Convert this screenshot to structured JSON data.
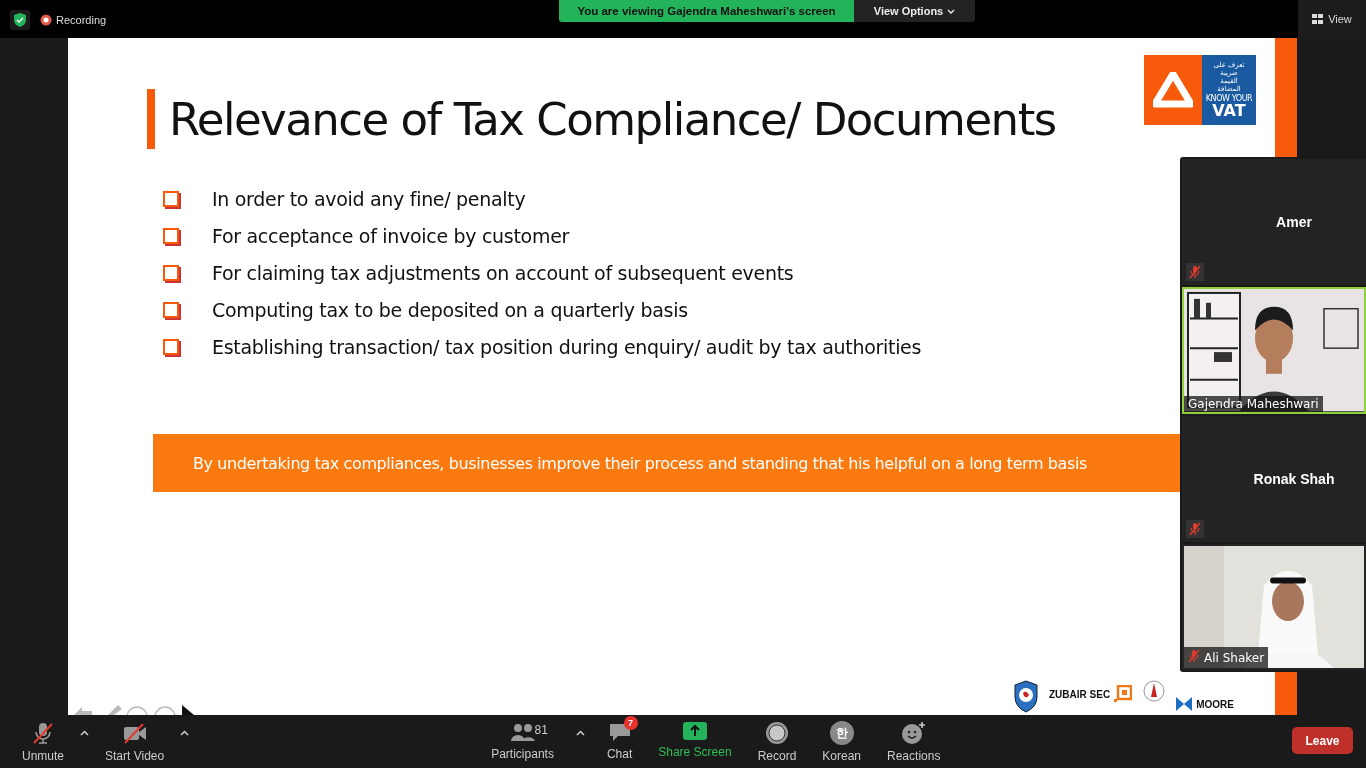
{
  "top_bar": {
    "recording": "Recording",
    "banner": "You are viewing Gajendra Maheshwari's screen",
    "view_options": "View Options",
    "view": "View"
  },
  "slide": {
    "title": "Relevance of Tax Compliance/ Documents",
    "logo": {
      "arabic": [
        "تعرف على",
        "ضريبة",
        "القيمة",
        "المضافة"
      ],
      "english_top": "KNOW YOUR",
      "english_main": "VAT"
    },
    "bullets": [
      "In order to avoid any fine/ penalty",
      "For acceptance of invoice by customer",
      "For claiming tax adjustments on account of subsequent events",
      "Computing tax to be deposited on a quarterly basis",
      "Establishing transaction/ tax position during enquiry/ audit by tax authorities"
    ],
    "banner": "By undertaking tax compliances, businesses improve their process and standing that his helpful on a long term basis",
    "footer_logos": [
      {
        "kind": "shield"
      },
      {
        "kind": "zubair",
        "text": "ZUBAIR SEC"
      },
      {
        "kind": "emblem"
      },
      {
        "kind": "moore",
        "text": "MOORE"
      }
    ]
  },
  "participants": [
    {
      "name": "Amer",
      "kind": "avatar",
      "muted": true,
      "speaking": false
    },
    {
      "name": "Gajendra Maheshwari",
      "kind": "video",
      "muted": false,
      "speaking": true
    },
    {
      "name": "Ronak Shah",
      "kind": "avatar",
      "muted": true,
      "speaking": false
    },
    {
      "name": "Ali Shaker",
      "kind": "video",
      "muted": true,
      "speaking": false
    }
  ],
  "toolbar": {
    "left": [
      {
        "kind": "mic",
        "label": "Unmute",
        "off": true
      },
      {
        "kind": "video",
        "label": "Start Video",
        "off": true
      }
    ],
    "center": [
      {
        "kind": "participants",
        "label": "Participants",
        "count": "81"
      },
      {
        "kind": "chat",
        "label": "Chat",
        "badge": "7"
      },
      {
        "kind": "share",
        "label": "Share Screen"
      },
      {
        "kind": "record",
        "label": "Record"
      },
      {
        "kind": "language",
        "label": "Korean",
        "glyph": "한"
      },
      {
        "kind": "reactions",
        "label": "Reactions"
      }
    ],
    "leave": "Leave"
  }
}
